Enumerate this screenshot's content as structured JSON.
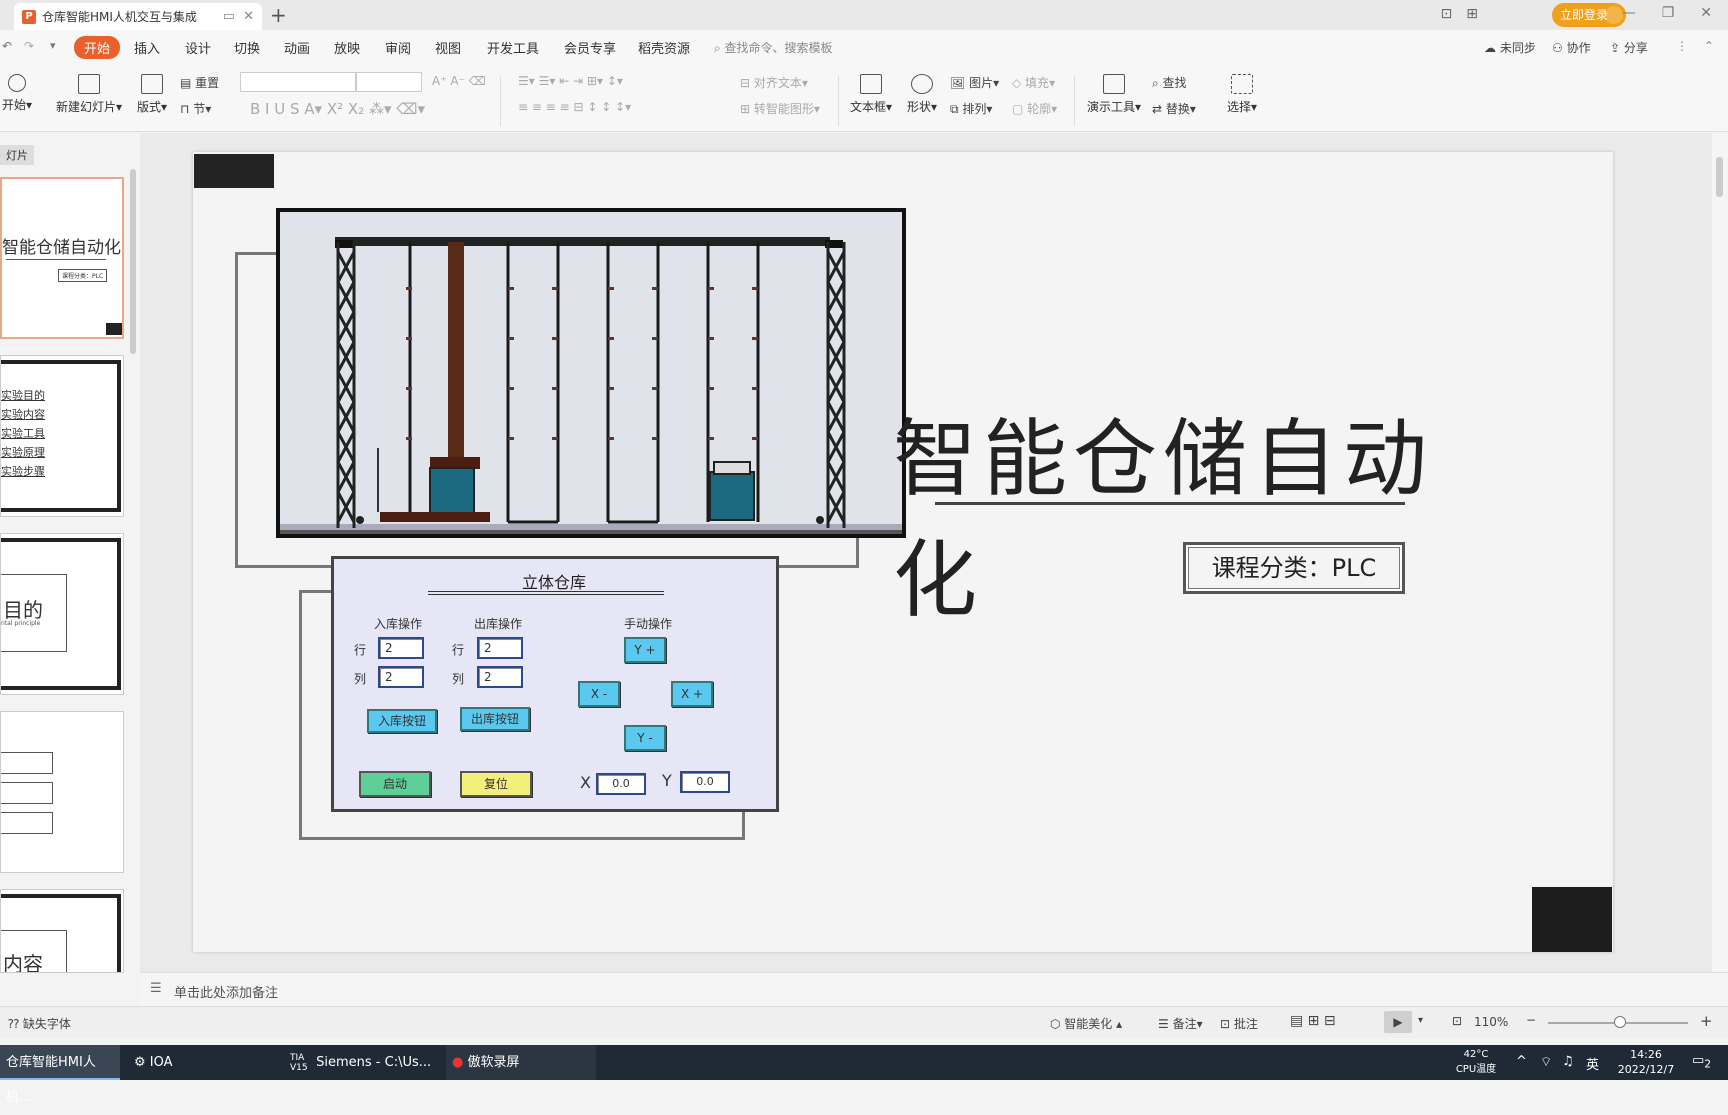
{
  "titlebar": {
    "doc_tab": "仓库智能HMI人机交互与集成",
    "login": "立即登录"
  },
  "menu": {
    "items": [
      "开始",
      "插入",
      "设计",
      "切换",
      "动画",
      "放映",
      "审阅",
      "视图",
      "开发工具",
      "会员专享",
      "稻壳资源"
    ],
    "search": "查找命令、搜索模板",
    "sync": "未同步",
    "collab": "协作",
    "share": "分享"
  },
  "ribbon": {
    "start": "开始",
    "new_slide": "新建幻灯片",
    "layout": "版式",
    "reset": "重置",
    "section": "节",
    "align_text": "对齐文本",
    "smartart": "转智能图形",
    "textbox": "文本框",
    "shape": "形状",
    "picture": "图片",
    "arrange": "排列",
    "fill": "填充",
    "outline": "轮廓",
    "present_tools": "演示工具",
    "find": "查找",
    "replace": "替换",
    "select": "选择",
    "text_direction": "文字方向"
  },
  "leftpanel": {
    "label": "灯片",
    "thumbs": [
      {
        "title": "智能仓储自动化",
        "sub": "课程分类：PLC"
      },
      {
        "items": [
          "实验目的",
          "实验内容",
          "实验工具",
          "实验原理",
          "实验步骤"
        ]
      },
      {
        "title": "目的",
        "sub": "ntal principle"
      },
      {
        "title": ""
      },
      {
        "title": "内容"
      }
    ]
  },
  "slide": {
    "title": "智能仓储自动化",
    "category": "课程分类：PLC"
  },
  "hmi": {
    "title": "立体仓库",
    "in_op": "入库操作",
    "out_op": "出库操作",
    "manual_op": "手动操作",
    "row_label": "行",
    "col_label": "列",
    "in_row": "2",
    "in_col": "2",
    "out_row": "2",
    "out_col": "2",
    "in_btn": "入库按钮",
    "out_btn": "出库按钮",
    "y_plus": "Y +",
    "y_minus": "Y -",
    "x_minus": "X -",
    "x_plus": "X +",
    "start": "启动",
    "reset": "复位",
    "x_label": "X",
    "y_label": "Y",
    "x_val": "0.0",
    "y_val": "0.0"
  },
  "notes": {
    "placeholder": "单击此处添加备注"
  },
  "status": {
    "missing_font": "缺失字体",
    "beautify": "智能美化",
    "notes": "备注",
    "comment": "批注",
    "zoom": "110%"
  },
  "taskbar": {
    "items": [
      "仓库智能HMI人机...",
      "IOA",
      "Siemens  -  C:\\Us...",
      "傲软录屏"
    ],
    "tia": "TIA V15",
    "temp": "42°C",
    "cpu": "CPU温度",
    "ime": "英",
    "time": "14:26",
    "date": "2022/12/7",
    "notif": "2"
  }
}
